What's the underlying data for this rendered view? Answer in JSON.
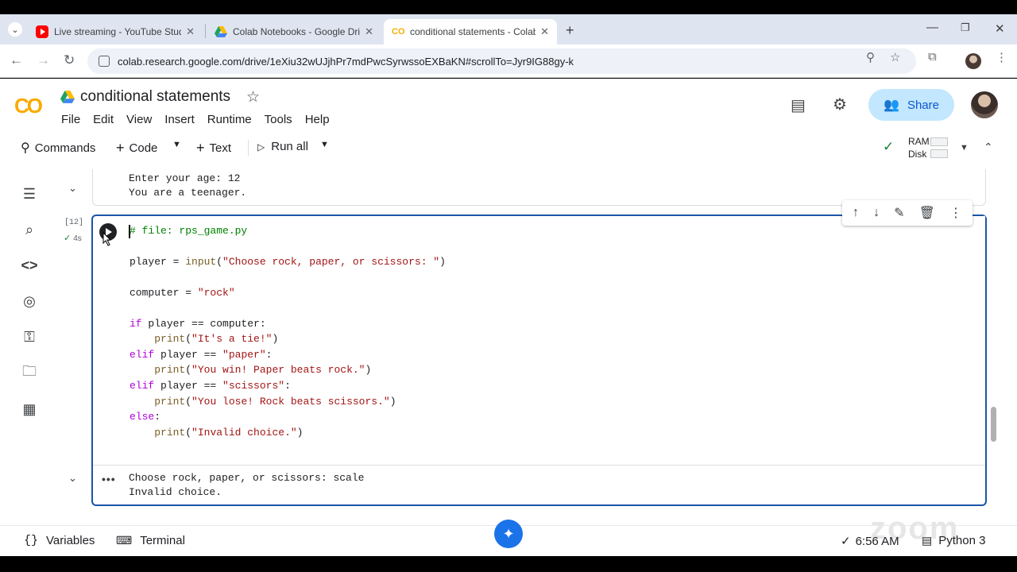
{
  "browser": {
    "tabs": [
      {
        "label": "Live streaming - YouTube Studio",
        "active": false
      },
      {
        "label": "Colab Notebooks - Google Drive",
        "active": false
      },
      {
        "label": "conditional statements - Colab",
        "active": true
      }
    ],
    "url": "colab.research.google.com/drive/1eXiu32wUJjhPr7mdPwcSyrwssoEXBaKN#scrollTo=Jyr9IG88gy-k"
  },
  "colab": {
    "logo": "CO",
    "title": "conditional statements",
    "menu": [
      "File",
      "Edit",
      "View",
      "Insert",
      "Runtime",
      "Tools",
      "Help"
    ],
    "share_label": "Share",
    "toolbar": {
      "commands": "Commands",
      "code": "Code",
      "text": "Text",
      "run_all": "Run all",
      "ram": "RAM",
      "disk": "Disk"
    }
  },
  "prev_output": [
    "Enter your age: 12",
    "You are a teenager."
  ],
  "cell": {
    "exec_count": "[12]",
    "exec_time": "4s",
    "code": {
      "l1": "# file: rps_game.py",
      "l2a": "player = ",
      "l2b": "input",
      "l2c": "(",
      "l2d": "\"Choose rock, paper, or scissors: \"",
      "l2e": ")",
      "l3a": "computer = ",
      "l3b": "\"rock\"",
      "l4a": "if",
      "l4b": " player == computer:",
      "l5a": "    ",
      "l5b": "print",
      "l5c": "(",
      "l5d": "\"It's a tie!\"",
      "l5e": ")",
      "l6a": "elif",
      "l6b": " player == ",
      "l6c": "\"paper\"",
      "l6d": ":",
      "l7d": "\"You win! Paper beats rock.\"",
      "l8a": "elif",
      "l8b": " player == ",
      "l8c": "\"scissors\"",
      "l8d": ":",
      "l9d": "\"You lose! Rock beats scissors.\"",
      "l10a": "else",
      "l10b": ":",
      "l11d": "\"Invalid choice.\""
    },
    "output": [
      "Choose rock, paper, or scissors: scale",
      "Invalid choice."
    ]
  },
  "statusbar": {
    "variables": "Variables",
    "terminal": "Terminal",
    "time": "6:56 AM",
    "runtime": "Python 3"
  }
}
